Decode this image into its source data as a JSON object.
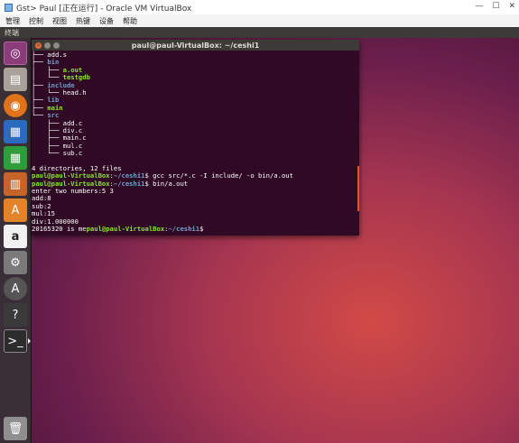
{
  "vb_window": {
    "title": "Gst> Paul [正在运行] - Oracle VM VirtualBox",
    "menu": [
      "管理",
      "控制",
      "视图",
      "热键",
      "设备",
      "帮助"
    ],
    "controls": [
      "—",
      "☐",
      "✕"
    ]
  },
  "ubuntu_topbar": {
    "app_name": "终端"
  },
  "launcher": {
    "items": [
      {
        "name": "dash",
        "glyph": "◎"
      },
      {
        "name": "files",
        "glyph": "▤"
      },
      {
        "name": "firefox",
        "glyph": "◉"
      },
      {
        "name": "writer",
        "glyph": "▦"
      },
      {
        "name": "calc",
        "glyph": "▦"
      },
      {
        "name": "impress",
        "glyph": "▥"
      },
      {
        "name": "software-center",
        "glyph": "A"
      },
      {
        "name": "amazon",
        "glyph": "a"
      },
      {
        "name": "system-settings",
        "glyph": "⚙"
      },
      {
        "name": "software-updater",
        "glyph": "A"
      },
      {
        "name": "unknown-app",
        "glyph": "?"
      },
      {
        "name": "terminal",
        "glyph": ">_"
      },
      {
        "name": "trash",
        "glyph": "🗑"
      }
    ]
  },
  "terminal": {
    "title": "paul@paul-VirtualBox: ~/ceshi1",
    "lines": [
      [
        {
          "t": "├── add.s",
          "c": ""
        }
      ],
      [
        {
          "t": "├── ",
          "c": ""
        },
        {
          "t": "bin",
          "c": "dir"
        }
      ],
      [
        {
          "t": "│   ├── ",
          "c": ""
        },
        {
          "t": "a.out",
          "c": "exe"
        }
      ],
      [
        {
          "t": "│   └── ",
          "c": ""
        },
        {
          "t": "testgdb",
          "c": "exe"
        }
      ],
      [
        {
          "t": "├── ",
          "c": ""
        },
        {
          "t": "include",
          "c": "dir"
        }
      ],
      [
        {
          "t": "│   └── head.h",
          "c": ""
        }
      ],
      [
        {
          "t": "├── ",
          "c": ""
        },
        {
          "t": "lib",
          "c": "dir"
        }
      ],
      [
        {
          "t": "├── ",
          "c": ""
        },
        {
          "t": "main",
          "c": "exe"
        }
      ],
      [
        {
          "t": "└── ",
          "c": ""
        },
        {
          "t": "src",
          "c": "dir"
        }
      ],
      [
        {
          "t": "    ├── add.c",
          "c": ""
        }
      ],
      [
        {
          "t": "    ├── div.c",
          "c": ""
        }
      ],
      [
        {
          "t": "    ├── main.c",
          "c": ""
        }
      ],
      [
        {
          "t": "    ├── mul.c",
          "c": ""
        }
      ],
      [
        {
          "t": "    └── sub.c",
          "c": ""
        }
      ],
      [
        {
          "t": "",
          "c": ""
        }
      ],
      [
        {
          "t": "4 directories, 12 files",
          "c": ""
        }
      ],
      [
        {
          "t": "paul@paul-VirtualBox",
          "c": "prompt"
        },
        {
          "t": ":",
          "c": ""
        },
        {
          "t": "~/ceshi1",
          "c": "path"
        },
        {
          "t": "$ gcc src/*.c -I include/ -o bin/a.out",
          "c": ""
        }
      ],
      [
        {
          "t": "paul@paul-VirtualBox",
          "c": "prompt"
        },
        {
          "t": ":",
          "c": ""
        },
        {
          "t": "~/ceshi1",
          "c": "path"
        },
        {
          "t": "$ bin/a.out",
          "c": ""
        }
      ],
      [
        {
          "t": "enter two numbers:5 3",
          "c": ""
        }
      ],
      [
        {
          "t": "add:8",
          "c": ""
        }
      ],
      [
        {
          "t": "sub:2",
          "c": ""
        }
      ],
      [
        {
          "t": "mul:15",
          "c": ""
        }
      ],
      [
        {
          "t": "div:1.000000",
          "c": ""
        }
      ],
      [
        {
          "t": "20165320 is me",
          "c": ""
        },
        {
          "t": "paul@paul-VirtualBox",
          "c": "prompt"
        },
        {
          "t": ":",
          "c": ""
        },
        {
          "t": "~/ceshi1",
          "c": "path"
        },
        {
          "t": "$ ",
          "c": ""
        }
      ]
    ]
  }
}
